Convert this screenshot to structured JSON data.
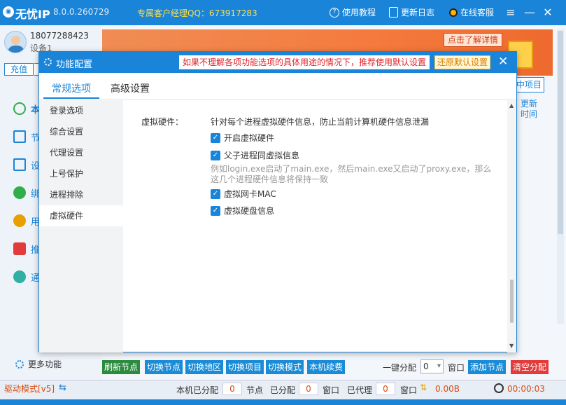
{
  "app": {
    "name": "无忧IP",
    "version": "8.0.0.260729",
    "qq_label": "专属客户经理QQ：673917283",
    "menu": [
      "使用教程",
      "更新日志",
      "在线客服"
    ]
  },
  "sidebar": {
    "phone": "18077288423",
    "device": "设备1",
    "charge": "充值",
    "items": [
      "本",
      "节",
      "设",
      "绑",
      "用",
      "推",
      "通"
    ],
    "more": "更多功能"
  },
  "banner": {
    "details_button": "点击了解详情"
  },
  "right_panel": {
    "tab": "中项目",
    "update_time": "更新时间"
  },
  "dialog": {
    "title": "功能配置",
    "warning": "如果不理解各项功能选项的具体用途的情况下，推荐使用默认设置",
    "restore_default": "还原默认设置",
    "tabs": [
      "常规选项",
      "高级设置"
    ],
    "nav": [
      "登录选项",
      "综合设置",
      "代理设置",
      "上号保护",
      "进程排除",
      "虚拟硬件"
    ],
    "section_title": "虚拟硬件：",
    "section_desc": "针对每个进程虚拟硬件信息，防止当前计算机硬件信息泄漏",
    "options": [
      {
        "label": "开启虚拟硬件",
        "checked": true
      },
      {
        "label": "父子进程同虚拟信息",
        "checked": true
      },
      {
        "label": "虚拟网卡MAC",
        "checked": true
      },
      {
        "label": "虚拟硬盘信息",
        "checked": true
      }
    ],
    "note": "例如login.exe启动了main.exe，然后main.exe又启动了proxy.exe，那么这几个进程硬件信息将保持一致"
  },
  "toolbar": {
    "refresh": "刷新节点",
    "switch_node": "切换节点",
    "switch_region": "切换地区",
    "switch_project": "切换项目",
    "switch_mode": "切换模式",
    "renew": "本机续费",
    "one_click": "一键分配",
    "count": "0",
    "window": "窗口",
    "add_node": "添加节点",
    "clear": "清空分配"
  },
  "status": {
    "drive_mode": "驱动模式[v5]",
    "assigned_label": "本机已分配",
    "assigned_value": "0",
    "node_label": "节点",
    "allocated_label": "已分配",
    "allocated_value": "0",
    "window_label": "窗口",
    "proxied_label": "已代理",
    "proxied_value": "0",
    "window_label2": "窗口",
    "speed": "0.00B",
    "timer": "00:00:03"
  },
  "colors": {
    "accent": "#1a84d9",
    "warning_red": "#e0242b",
    "status_orange": "#d94b10"
  }
}
